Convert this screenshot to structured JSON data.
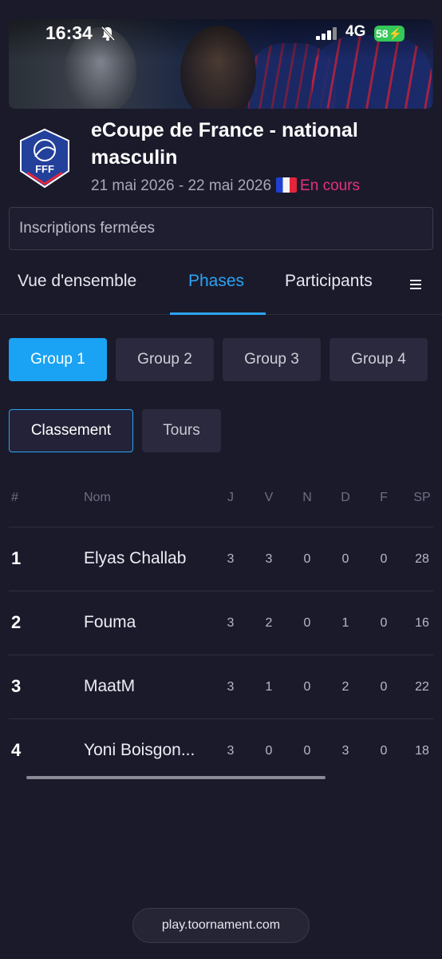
{
  "status_bar": {
    "time": "16:34",
    "network": "4G",
    "battery": "58"
  },
  "header": {
    "title": "eCoupe de France - national masculin",
    "dates": "21 mai 2026 - 22 mai 2026",
    "state": "En cours",
    "logo_text": "FFF"
  },
  "registration": "Inscriptions fermées",
  "tabs": [
    {
      "label": "Vue d'ensemble"
    },
    {
      "label": "Phases",
      "active": true
    },
    {
      "label": "Participants"
    }
  ],
  "groups": [
    "Group 1",
    "Group 2",
    "Group 3",
    "Group 4"
  ],
  "subtabs": [
    "Classement",
    "Tours"
  ],
  "table": {
    "headers": [
      "#",
      "Nom",
      "J",
      "V",
      "N",
      "D",
      "F",
      "SP"
    ],
    "rows": [
      {
        "rank": "1",
        "name": "Elyas Challab",
        "J": "3",
        "V": "3",
        "N": "0",
        "D": "0",
        "F": "0",
        "SP": "28"
      },
      {
        "rank": "2",
        "name": "Fouma",
        "J": "3",
        "V": "2",
        "N": "0",
        "D": "1",
        "F": "0",
        "SP": "16"
      },
      {
        "rank": "3",
        "name": "MaatM",
        "J": "3",
        "V": "1",
        "N": "0",
        "D": "2",
        "F": "0",
        "SP": "22"
      },
      {
        "rank": "4",
        "name": "Yoni Boisgon...",
        "J": "3",
        "V": "0",
        "N": "0",
        "D": "3",
        "F": "0",
        "SP": "18"
      }
    ]
  },
  "browser_url": "play.toornament.com",
  "colors": {
    "accent": "#2ba4f5",
    "live": "#e8317a",
    "background": "#1b1a2b"
  }
}
